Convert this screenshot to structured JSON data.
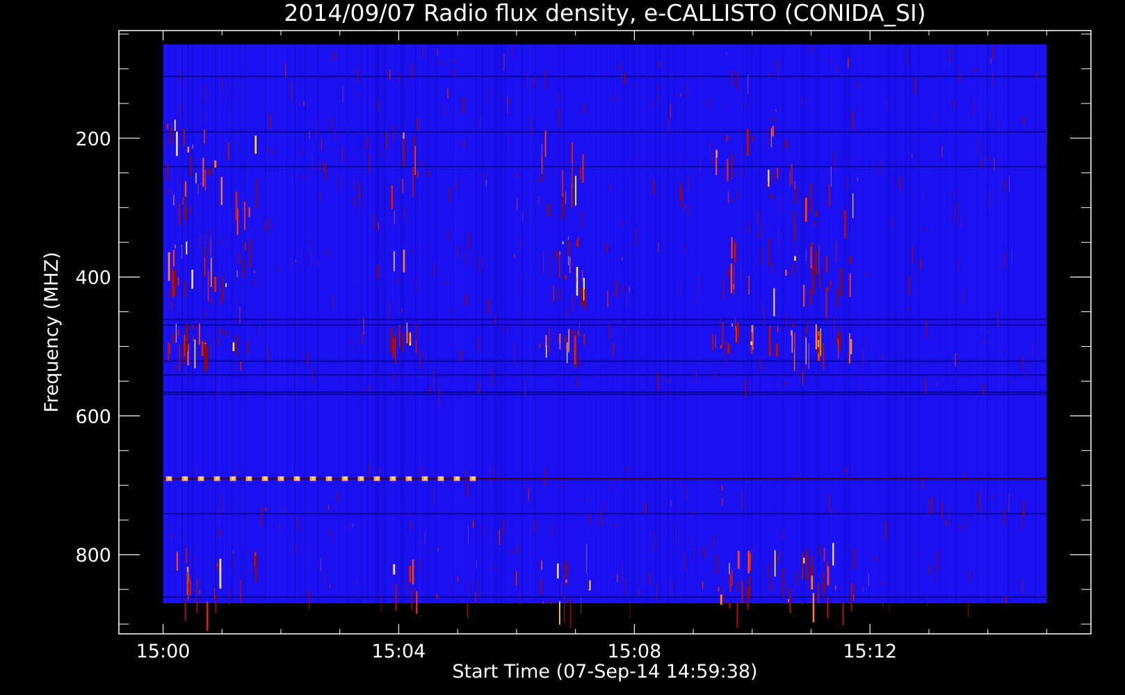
{
  "chart_data": {
    "type": "heatmap",
    "title": "2014/09/07  Radio flux density, e-CALLISTO (CONIDA_SI)",
    "xlabel": "Start Time (07-Sep-14 14:59:38)",
    "ylabel": "Frequency (MHZ)",
    "x_ticks": [
      "15:00",
      "15:04",
      "15:08",
      "15:12"
    ],
    "x_tick_minutes": [
      0,
      4,
      8,
      12
    ],
    "x_range_minutes": [
      -0.75,
      15.75
    ],
    "x_data_range_minutes": [
      0,
      15
    ],
    "y_ticks": [
      200,
      400,
      600,
      800
    ],
    "y_range": [
      45,
      914
    ],
    "y_data_range": [
      65,
      870
    ],
    "y_axis_inverted": true,
    "background_band_color": "#1a10f0",
    "colormap": [
      "#000000",
      "#1a10f0",
      "#b01010",
      "#ff4010",
      "#ffe060"
    ],
    "burst_columns_minutes": [
      0.3,
      0.5,
      0.9,
      1.4,
      4.1,
      6.6,
      6.9,
      7.0,
      9.5,
      9.8,
      10.5,
      10.9,
      11.1,
      11.5
    ],
    "burst_bands_mhz": [
      [
        170,
        310
      ],
      [
        340,
        420
      ],
      [
        465,
        500
      ],
      [
        780,
        870
      ]
    ],
    "calibration_line_mhz": 690,
    "calibration_marks_end_minutes": 5.3,
    "quiet_band_mhz": [
      560,
      670
    ]
  }
}
